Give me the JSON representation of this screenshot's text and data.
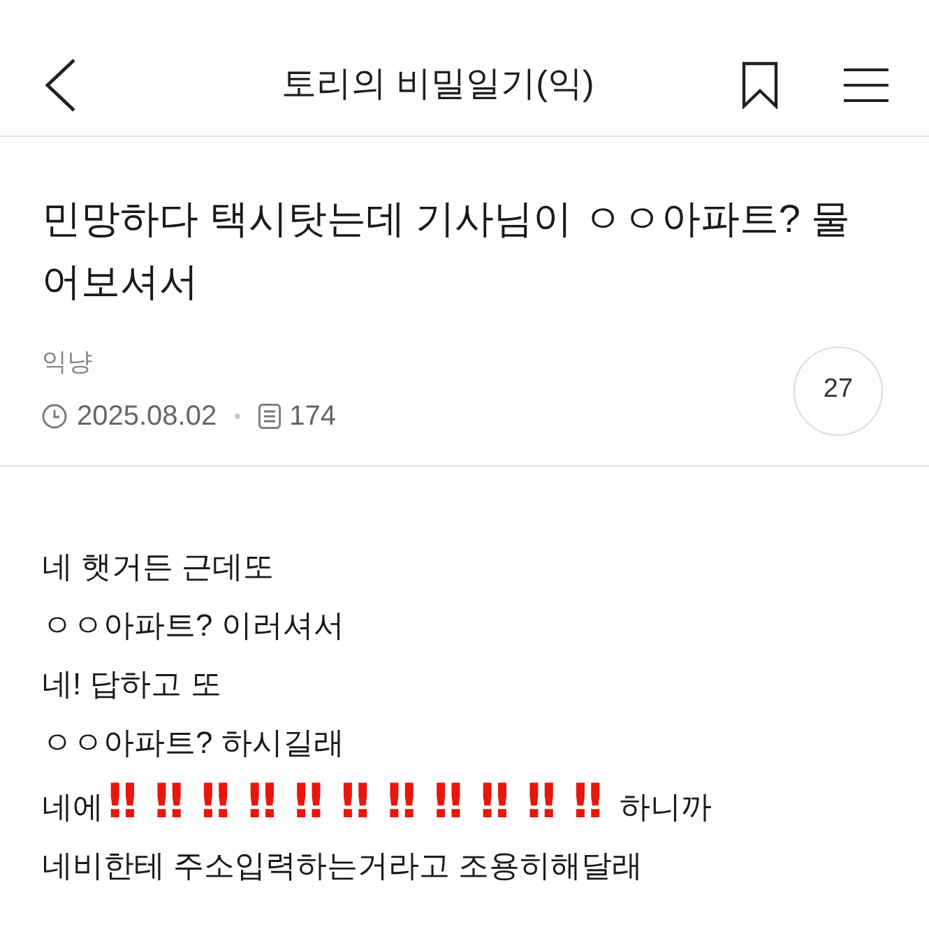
{
  "header": {
    "title": "토리의 비밀일기(익)"
  },
  "post": {
    "title": "민망하다 택시탓는데 기사님이 ㅇㅇ아파트? 물어보셔서",
    "author": "익냥",
    "date": "2025.08.02",
    "views": "174",
    "comment_count": "27"
  },
  "body": {
    "lines": [
      {
        "parts": [
          {
            "kind": "plain",
            "text": "네 햇거든 근데또"
          }
        ]
      },
      {
        "parts": [
          {
            "kind": "plain",
            "text": "ㅇㅇ아파트? 이러셔서"
          }
        ]
      },
      {
        "parts": [
          {
            "kind": "plain",
            "text": "네! 답하고 또"
          }
        ]
      },
      {
        "parts": [
          {
            "kind": "plain",
            "text": "ㅇㅇ아파트? 하시길래"
          }
        ]
      },
      {
        "parts": [
          {
            "kind": "plain",
            "text": "네에"
          },
          {
            "kind": "emoji",
            "text": "‼‼‼‼‼‼‼‼‼‼‼"
          },
          {
            "kind": "plain",
            "text": "하니까"
          }
        ]
      },
      {
        "parts": [
          {
            "kind": "plain",
            "text": "네비한테 주소입력하는거라고 조용히해달래"
          }
        ]
      }
    ]
  }
}
